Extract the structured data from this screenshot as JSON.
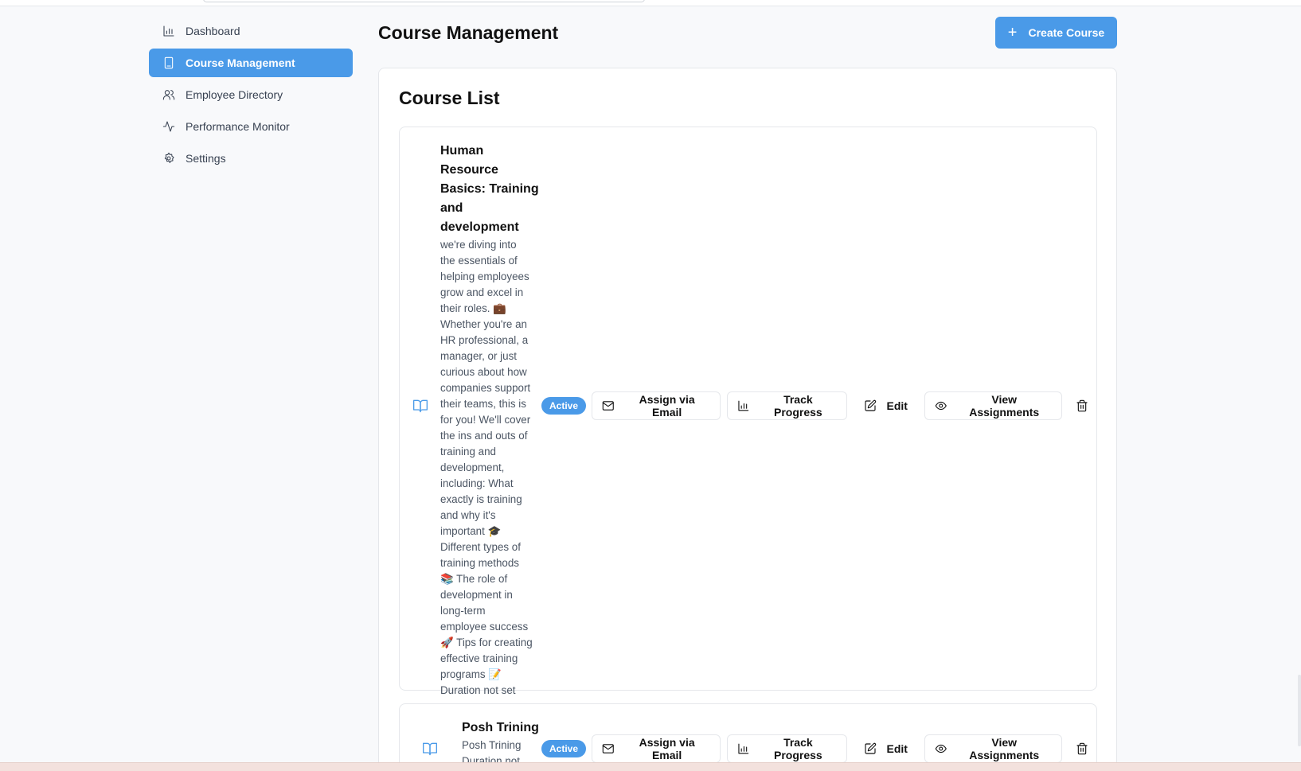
{
  "sidebar": {
    "items": [
      {
        "label": "Dashboard",
        "icon": "bar-chart-icon",
        "active": false
      },
      {
        "label": "Course Management",
        "icon": "tablet-icon",
        "active": true
      },
      {
        "label": "Employee Directory",
        "icon": "users-icon",
        "active": false
      },
      {
        "label": "Performance Monitor",
        "icon": "activity-icon",
        "active": false
      },
      {
        "label": "Settings",
        "icon": "gear-icon",
        "active": false
      }
    ]
  },
  "header": {
    "title": "Course Management",
    "create_label": "Create Course"
  },
  "course_list": {
    "title": "Course List",
    "courses": [
      {
        "title_lines": [
          "Human Resource",
          "Basics: Training",
          "and",
          "development"
        ],
        "description_lines": [
          "we're diving into",
          "the essentials of",
          "helping employees",
          "grow and excel in",
          "their roles. 💼",
          "Whether you're an",
          "HR professional, a",
          "manager, or just",
          "curious about how",
          "companies support",
          "their teams, this is",
          "for you! We'll cover",
          "the ins and outs of",
          "training and",
          "development,",
          "including: What",
          "exactly is training",
          "and why it's",
          "important 🎓",
          "Different types of",
          "training methods",
          "📚 The role of",
          "development in",
          "long-term",
          "employee success",
          "🚀 Tips for creating",
          "effective training",
          "programs 📝",
          "Duration not set"
        ],
        "status": "Active"
      },
      {
        "title_lines": [
          "Posh Trining"
        ],
        "description_lines": [
          "Posh Trining",
          "Duration not"
        ],
        "status": "Active"
      }
    ],
    "actions": {
      "assign": "Assign via Email",
      "track": "Track Progress",
      "edit": "Edit",
      "view": "View Assignments"
    }
  },
  "colors": {
    "accent": "#4a9ae8",
    "background": "#f8f9fb"
  }
}
